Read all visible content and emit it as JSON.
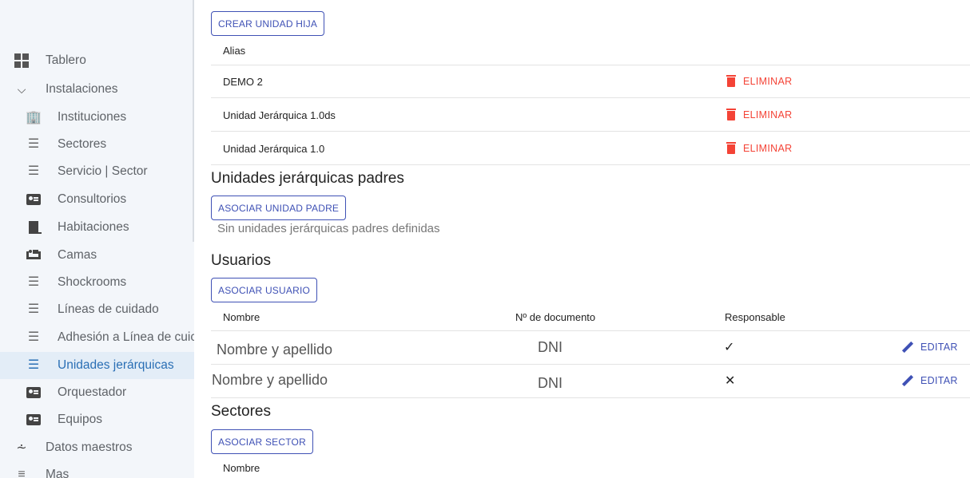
{
  "sidebar": {
    "items": [
      {
        "label": "Tablero",
        "icon": "dashboard-icon",
        "level": "top"
      },
      {
        "label": "Instalaciones",
        "icon": "chevron-down-icon",
        "level": "top"
      },
      {
        "label": "Instituciones",
        "icon": "building-icon",
        "level": "sub"
      },
      {
        "label": "Sectores",
        "icon": "list-icon",
        "level": "sub"
      },
      {
        "label": "Servicio | Sector",
        "icon": "list-icon",
        "level": "sub"
      },
      {
        "label": "Consultorios",
        "icon": "contact-card-icon",
        "level": "sub"
      },
      {
        "label": "Habitaciones",
        "icon": "door-icon",
        "level": "sub"
      },
      {
        "label": "Camas",
        "icon": "bed-icon",
        "level": "sub"
      },
      {
        "label": "Shockrooms",
        "icon": "list-icon",
        "level": "sub"
      },
      {
        "label": "Líneas de cuidado",
        "icon": "list-icon",
        "level": "sub"
      },
      {
        "label": "Adhesión a Línea de cuic",
        "icon": "list-icon",
        "level": "sub"
      },
      {
        "label": "Unidades jerárquicas",
        "icon": "list-icon",
        "level": "sub",
        "active": true
      },
      {
        "label": "Orquestador",
        "icon": "contact-card-icon",
        "level": "sub"
      },
      {
        "label": "Equipos",
        "icon": "contact-card-icon",
        "level": "sub"
      },
      {
        "label": "Datos maestros",
        "icon": "sliders-icon",
        "level": "top"
      },
      {
        "label": "Mas",
        "icon": "more-list-icon",
        "level": "top"
      }
    ]
  },
  "child_units": {
    "create_button": "CREAR UNIDAD HIJA",
    "column_alias": "Alias",
    "delete_label": "ELIMINAR",
    "rows": [
      "DEMO 2",
      "Unidad Jerárquica 1.0ds",
      "Unidad Jerárquica 1.0"
    ]
  },
  "parent_units": {
    "title": "Unidades jerárquicas padres",
    "associate_button": "ASOCIAR UNIDAD PADRE",
    "empty_message": "Sin unidades jerárquicas padres definidas"
  },
  "users": {
    "title": "Usuarios",
    "associate_button": "ASOCIAR USUARIO",
    "columns": {
      "name": "Nombre",
      "document": "Nº de documento",
      "responsible": "Responsable"
    },
    "edit_label": "EDITAR",
    "rows": [
      {
        "name": "Nombre y apellido",
        "document": "DNI",
        "responsible": "✓"
      },
      {
        "name": "Nombre y apellido",
        "document": "DNI",
        "responsible": "✕"
      }
    ]
  },
  "sectors": {
    "title": "Sectores",
    "associate_button": "ASOCIAR SECTOR",
    "column_name": "Nombre"
  },
  "colors": {
    "primary": "#3f51b5",
    "danger": "#f44336",
    "sidebar_bg": "#f3f6fa",
    "active_item": "#2a6fb5"
  }
}
